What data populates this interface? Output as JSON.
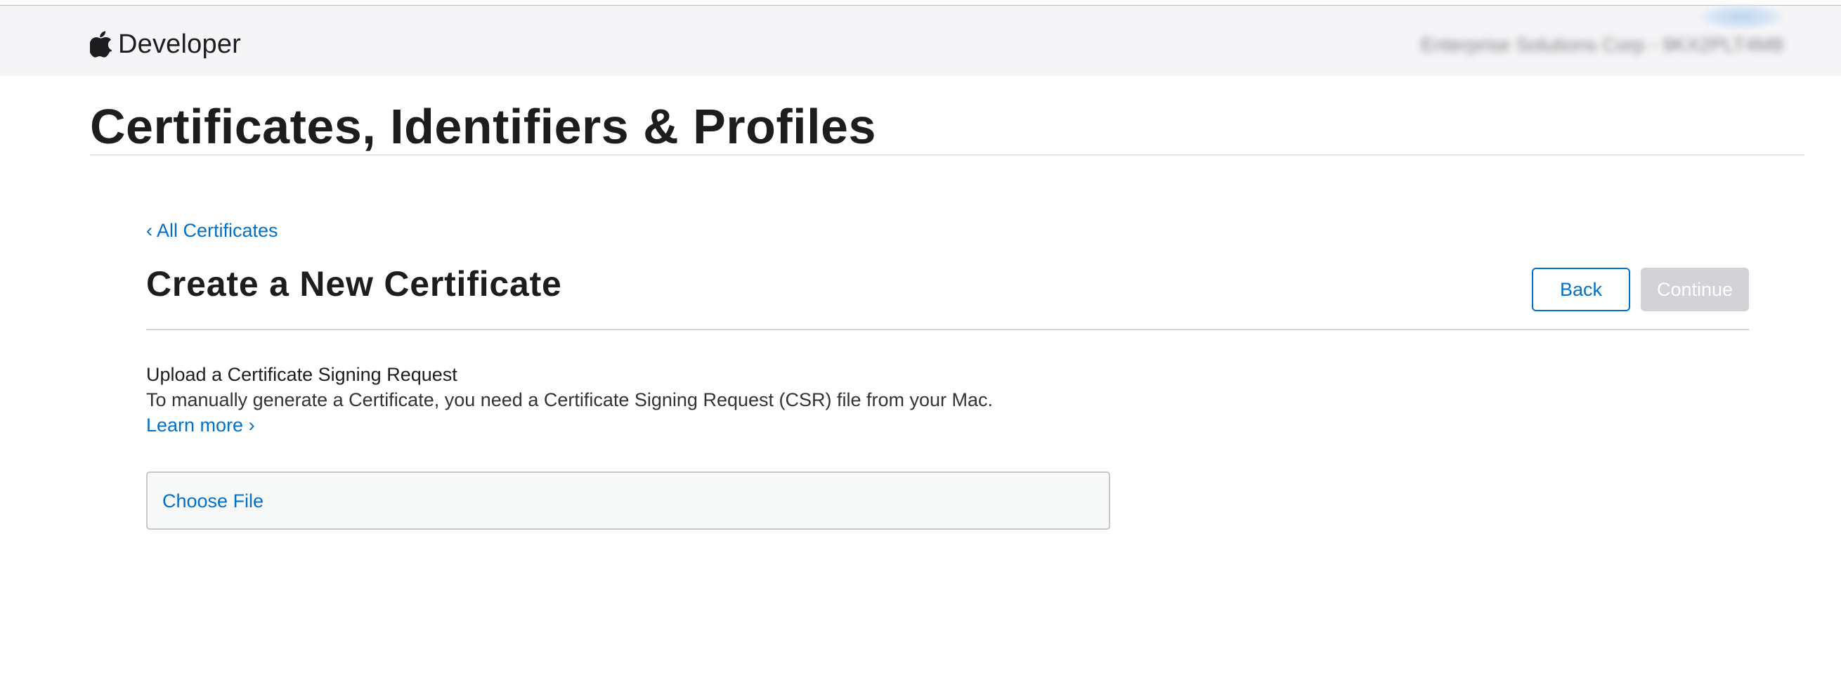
{
  "header": {
    "brand_label": "Developer",
    "logo_icon": "apple-logo-icon",
    "account_text": "Enterprise Solutions Corp - 9KX2PLT4M8"
  },
  "page": {
    "title": "Certificates, Identifiers & Profiles"
  },
  "breadcrumb": {
    "back_label": "‹ All Certificates"
  },
  "section": {
    "title": "Create a New Certificate",
    "back_button": "Back",
    "continue_button": "Continue",
    "continue_disabled": true
  },
  "upload": {
    "heading": "Upload a Certificate Signing Request",
    "description": "To manually generate a Certificate, you need a Certificate Signing Request (CSR) file from your Mac.",
    "learn_more": "Learn more ›",
    "choose_file": "Choose File"
  },
  "colors": {
    "link": "#0070c9",
    "header_bg": "#f5f5f7",
    "disabled_button": "#d2d2d7",
    "text": "#1d1d1f"
  }
}
